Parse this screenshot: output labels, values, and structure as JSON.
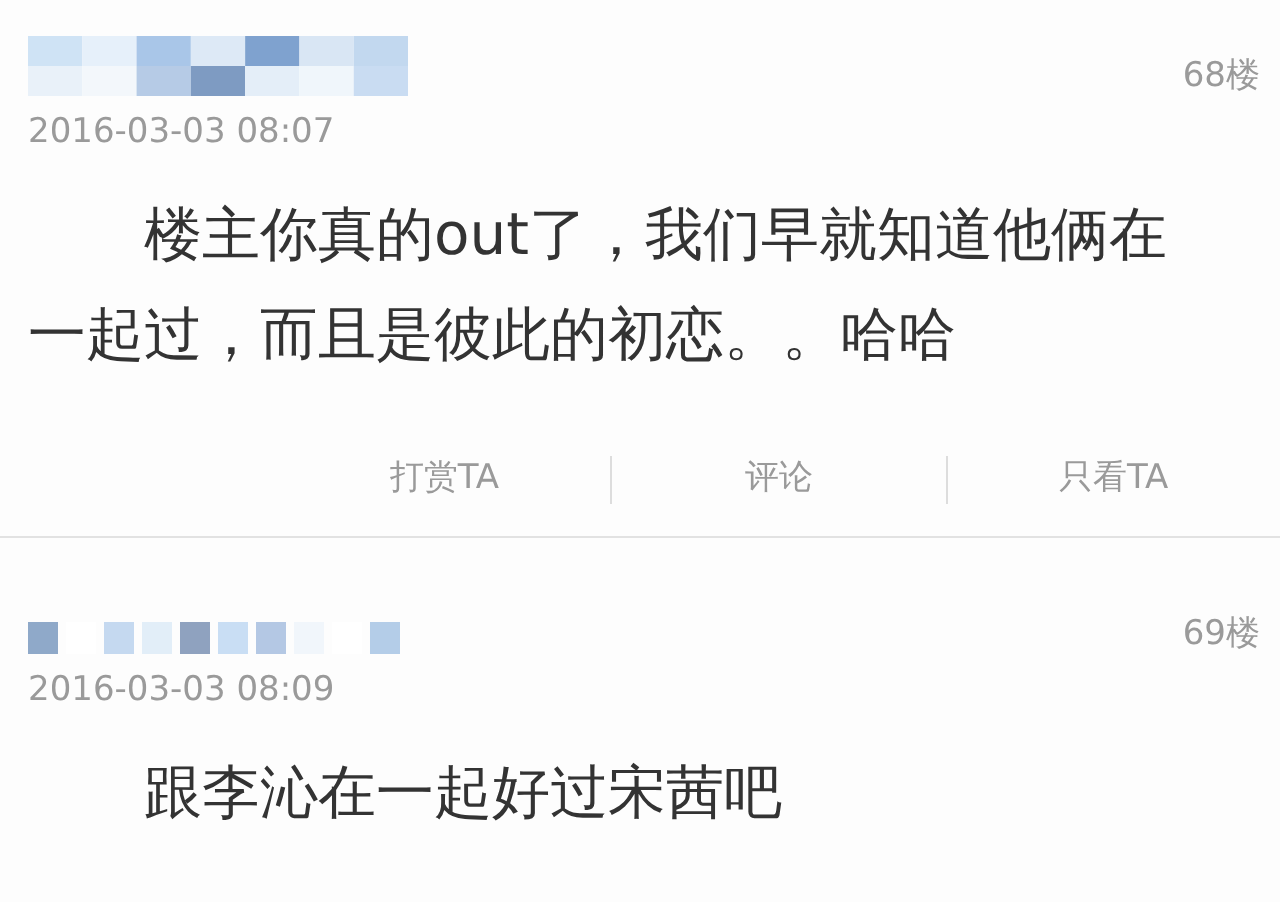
{
  "posts": [
    {
      "floor": "68楼",
      "time": "2016-03-03 08:07",
      "body": "楼主你真的out了，我们早就知道他俩在一起过，而且是彼此的初恋。。哈哈",
      "actions": [
        "打赏TA",
        "评论",
        "只看TA"
      ]
    },
    {
      "floor": "69楼",
      "time": "2016-03-03 08:09",
      "body": "跟李沁在一起好过宋茜吧"
    }
  ]
}
